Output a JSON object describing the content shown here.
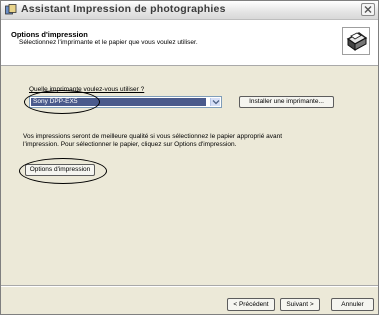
{
  "window": {
    "title": "Assistant Impression de photographies"
  },
  "header": {
    "title": "Options d'impression",
    "subtitle": "Sélectionnez l'imprimante et le papier que vous voulez utiliser."
  },
  "printer": {
    "question": "Quelle imprimante voulez-vous utiliser ?",
    "selected": "Sony DPP-EX5",
    "install_label": "Installer une imprimante..."
  },
  "info": {
    "line1": "Vos impressions seront de meilleure qualité si vous sélectionnez le papier approprié avant",
    "line2": "l'impression. Pour sélectionner le papier, cliquez sur Options d'impression."
  },
  "options_button": "Options d'impression",
  "footer": {
    "previous": "< Précédent",
    "next": "Suivant >",
    "cancel": "Annuler"
  },
  "icons": {
    "app": "photo-wizard-icon",
    "header": "printer-icon",
    "close": "close-icon",
    "combo_arrow": "chevron-down-icon"
  }
}
